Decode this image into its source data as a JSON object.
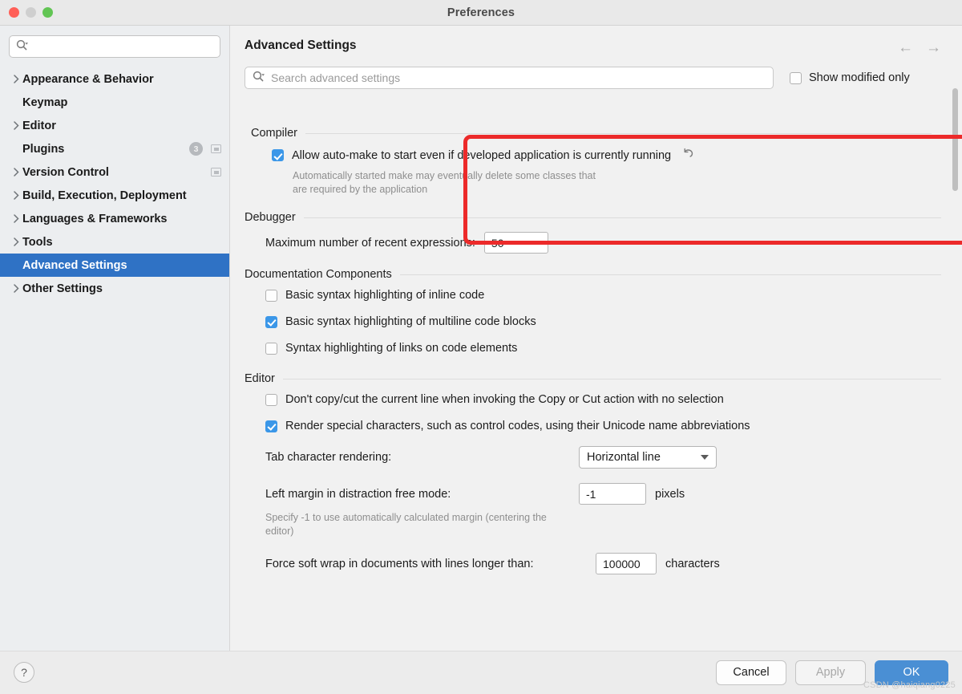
{
  "window": {
    "title": "Preferences",
    "traffic_lights": [
      "close",
      "minimize",
      "zoom"
    ]
  },
  "sidebar": {
    "search_placeholder": "",
    "items": [
      {
        "label": "Appearance & Behavior",
        "expandable": true,
        "selected": false,
        "badge": null,
        "window_icon": false
      },
      {
        "label": "Keymap",
        "expandable": false,
        "selected": false,
        "badge": null,
        "window_icon": false
      },
      {
        "label": "Editor",
        "expandable": true,
        "selected": false,
        "badge": null,
        "window_icon": false
      },
      {
        "label": "Plugins",
        "expandable": false,
        "selected": false,
        "badge": "3",
        "window_icon": true
      },
      {
        "label": "Version Control",
        "expandable": true,
        "selected": false,
        "badge": null,
        "window_icon": true
      },
      {
        "label": "Build, Execution, Deployment",
        "expandable": true,
        "selected": false,
        "badge": null,
        "window_icon": false
      },
      {
        "label": "Languages & Frameworks",
        "expandable": true,
        "selected": false,
        "badge": null,
        "window_icon": false
      },
      {
        "label": "Tools",
        "expandable": true,
        "selected": false,
        "badge": null,
        "window_icon": false
      },
      {
        "label": "Advanced Settings",
        "expandable": false,
        "selected": true,
        "badge": null,
        "window_icon": false
      },
      {
        "label": "Other Settings",
        "expandable": true,
        "selected": false,
        "badge": null,
        "window_icon": false
      }
    ]
  },
  "main": {
    "page_title": "Advanced Settings",
    "back_arrow": "←",
    "forward_arrow": "→",
    "search": {
      "placeholder": "Search advanced settings",
      "value": ""
    },
    "show_modified_only": {
      "label": "Show modified only",
      "checked": false
    }
  },
  "groups": {
    "compiler": {
      "title": "Compiler",
      "highlighted": true,
      "option": {
        "label": "Allow auto-make to start even if developed application is currently running",
        "checked": true,
        "revert_icon": "↺"
      },
      "hint_line1": "Automatically started make may eventually delete some classes that",
      "hint_line2": "are required by the application"
    },
    "debugger": {
      "title": "Debugger",
      "field_label": "Maximum number of recent expressions:",
      "field_value": "50"
    },
    "documentation": {
      "title": "Documentation Components",
      "options": [
        {
          "label": "Basic syntax highlighting of inline code",
          "checked": false
        },
        {
          "label": "Basic syntax highlighting of multiline code blocks",
          "checked": true
        },
        {
          "label": "Syntax highlighting of links on code elements",
          "checked": false
        }
      ]
    },
    "editor": {
      "title": "Editor",
      "options": [
        {
          "label": "Don't copy/cut the current line when invoking the Copy or Cut action with no selection",
          "checked": false
        },
        {
          "label": "Render special characters, such as control codes, using their Unicode name abbreviations",
          "checked": true
        }
      ],
      "tab_rendering": {
        "label": "Tab character rendering:",
        "value": "Horizontal line"
      },
      "left_margin": {
        "label": "Left margin in distraction free mode:",
        "value": "-1",
        "unit": "pixels",
        "hint_line1": "Specify -1 to use automatically calculated margin (centering the",
        "hint_line2": "editor)"
      },
      "soft_wrap": {
        "label": "Force soft wrap in documents with lines longer than:",
        "value": "100000",
        "unit": "characters"
      }
    }
  },
  "footer": {
    "help_label": "?",
    "cancel_label": "Cancel",
    "apply_label": "Apply",
    "ok_label": "OK"
  },
  "watermark": "CSDN @haiqiang0225",
  "colors": {
    "selection_blue": "#2f72c5",
    "checkbox_blue": "#3b97e8",
    "primary_button": "#4a8fd4",
    "annotation_red": "#ec2a2a"
  }
}
